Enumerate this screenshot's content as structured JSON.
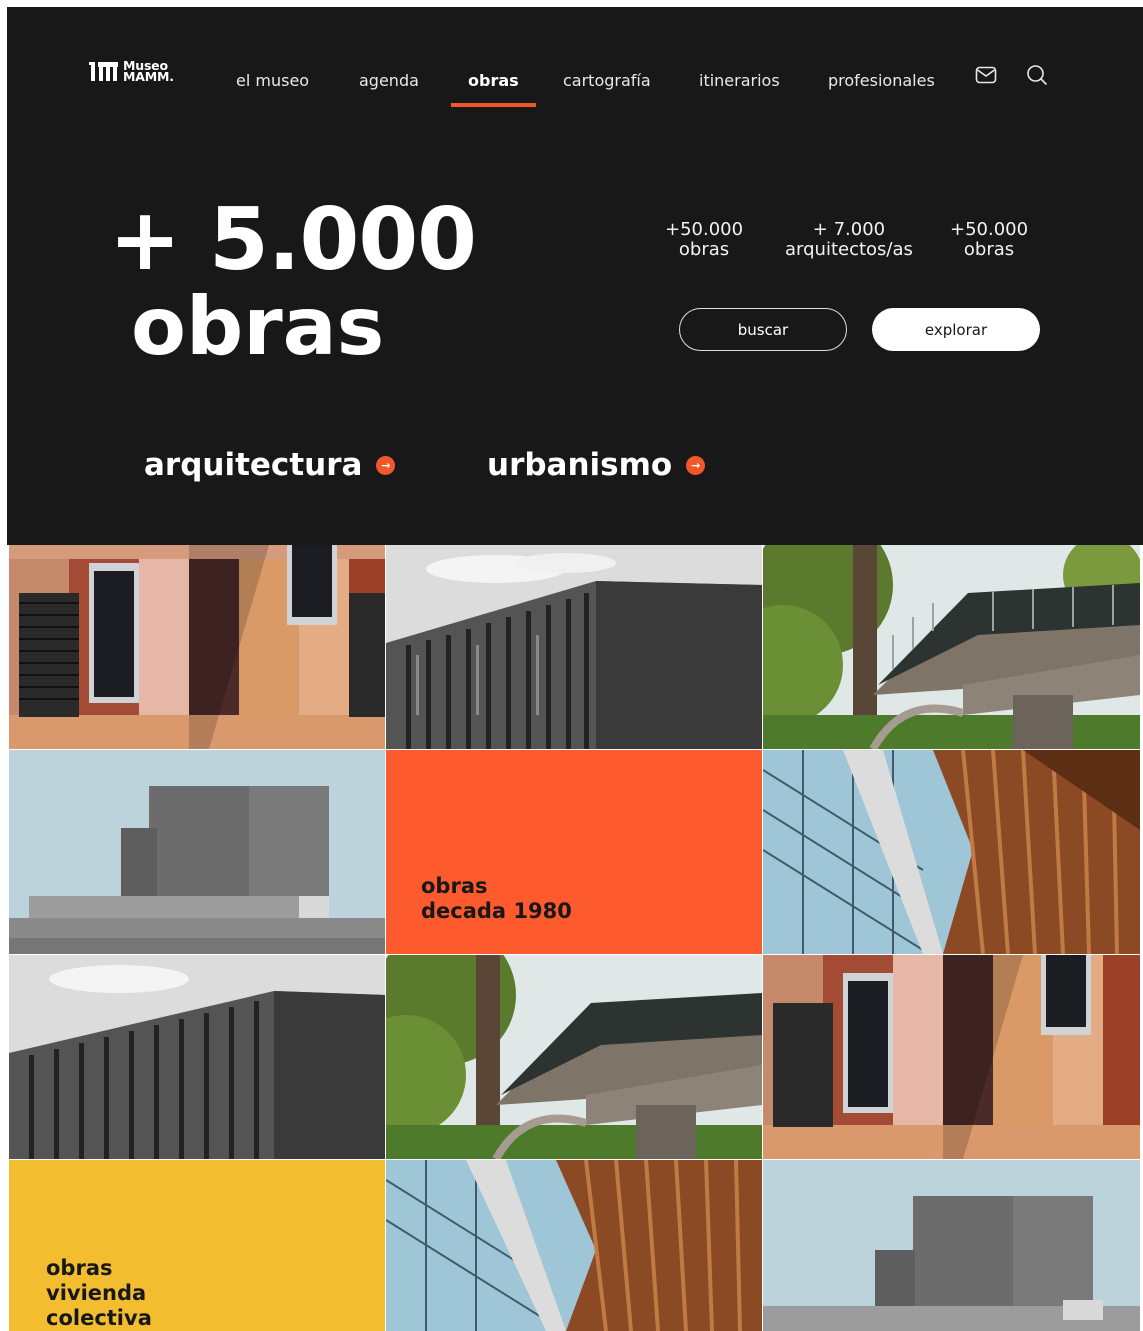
{
  "brand": {
    "line1": "Museo",
    "line2": "MAMM."
  },
  "nav": {
    "items": [
      {
        "label": "el museo"
      },
      {
        "label": "agenda"
      },
      {
        "label": "obras"
      },
      {
        "label": "cartografía"
      },
      {
        "label": "itinerarios"
      },
      {
        "label": "profesionales"
      }
    ],
    "active": "obras",
    "icons": [
      "mail-icon",
      "search-icon"
    ]
  },
  "hero": {
    "headline_line1": "+ 5.000",
    "headline_line2": "obras",
    "stats": [
      {
        "value": "+50.000",
        "label": "obras"
      },
      {
        "value": "+ 7.000",
        "label": "arquitectos/as"
      },
      {
        "value": "+50.000",
        "label": "obras"
      }
    ],
    "buttons": {
      "search": "buscar",
      "explore": "explorar"
    },
    "categories": [
      {
        "label": "arquitectura",
        "icon": "arrow-right-circle-icon"
      },
      {
        "label": "urbanismo",
        "icon": "arrow-right-circle-icon"
      }
    ]
  },
  "grid": {
    "feature_tiles": [
      {
        "line1": "obras",
        "line2": "decada 1980",
        "color": "#fd5a2e"
      },
      {
        "line1": "obras",
        "line2": "vivienda",
        "line3": "colectiva",
        "color": "#f2bd2f"
      }
    ]
  },
  "colors": {
    "accent": "#f2572b",
    "hero_bg": "#181818",
    "orange_tile": "#fd5a2e",
    "yellow_tile": "#f2bd2f"
  }
}
